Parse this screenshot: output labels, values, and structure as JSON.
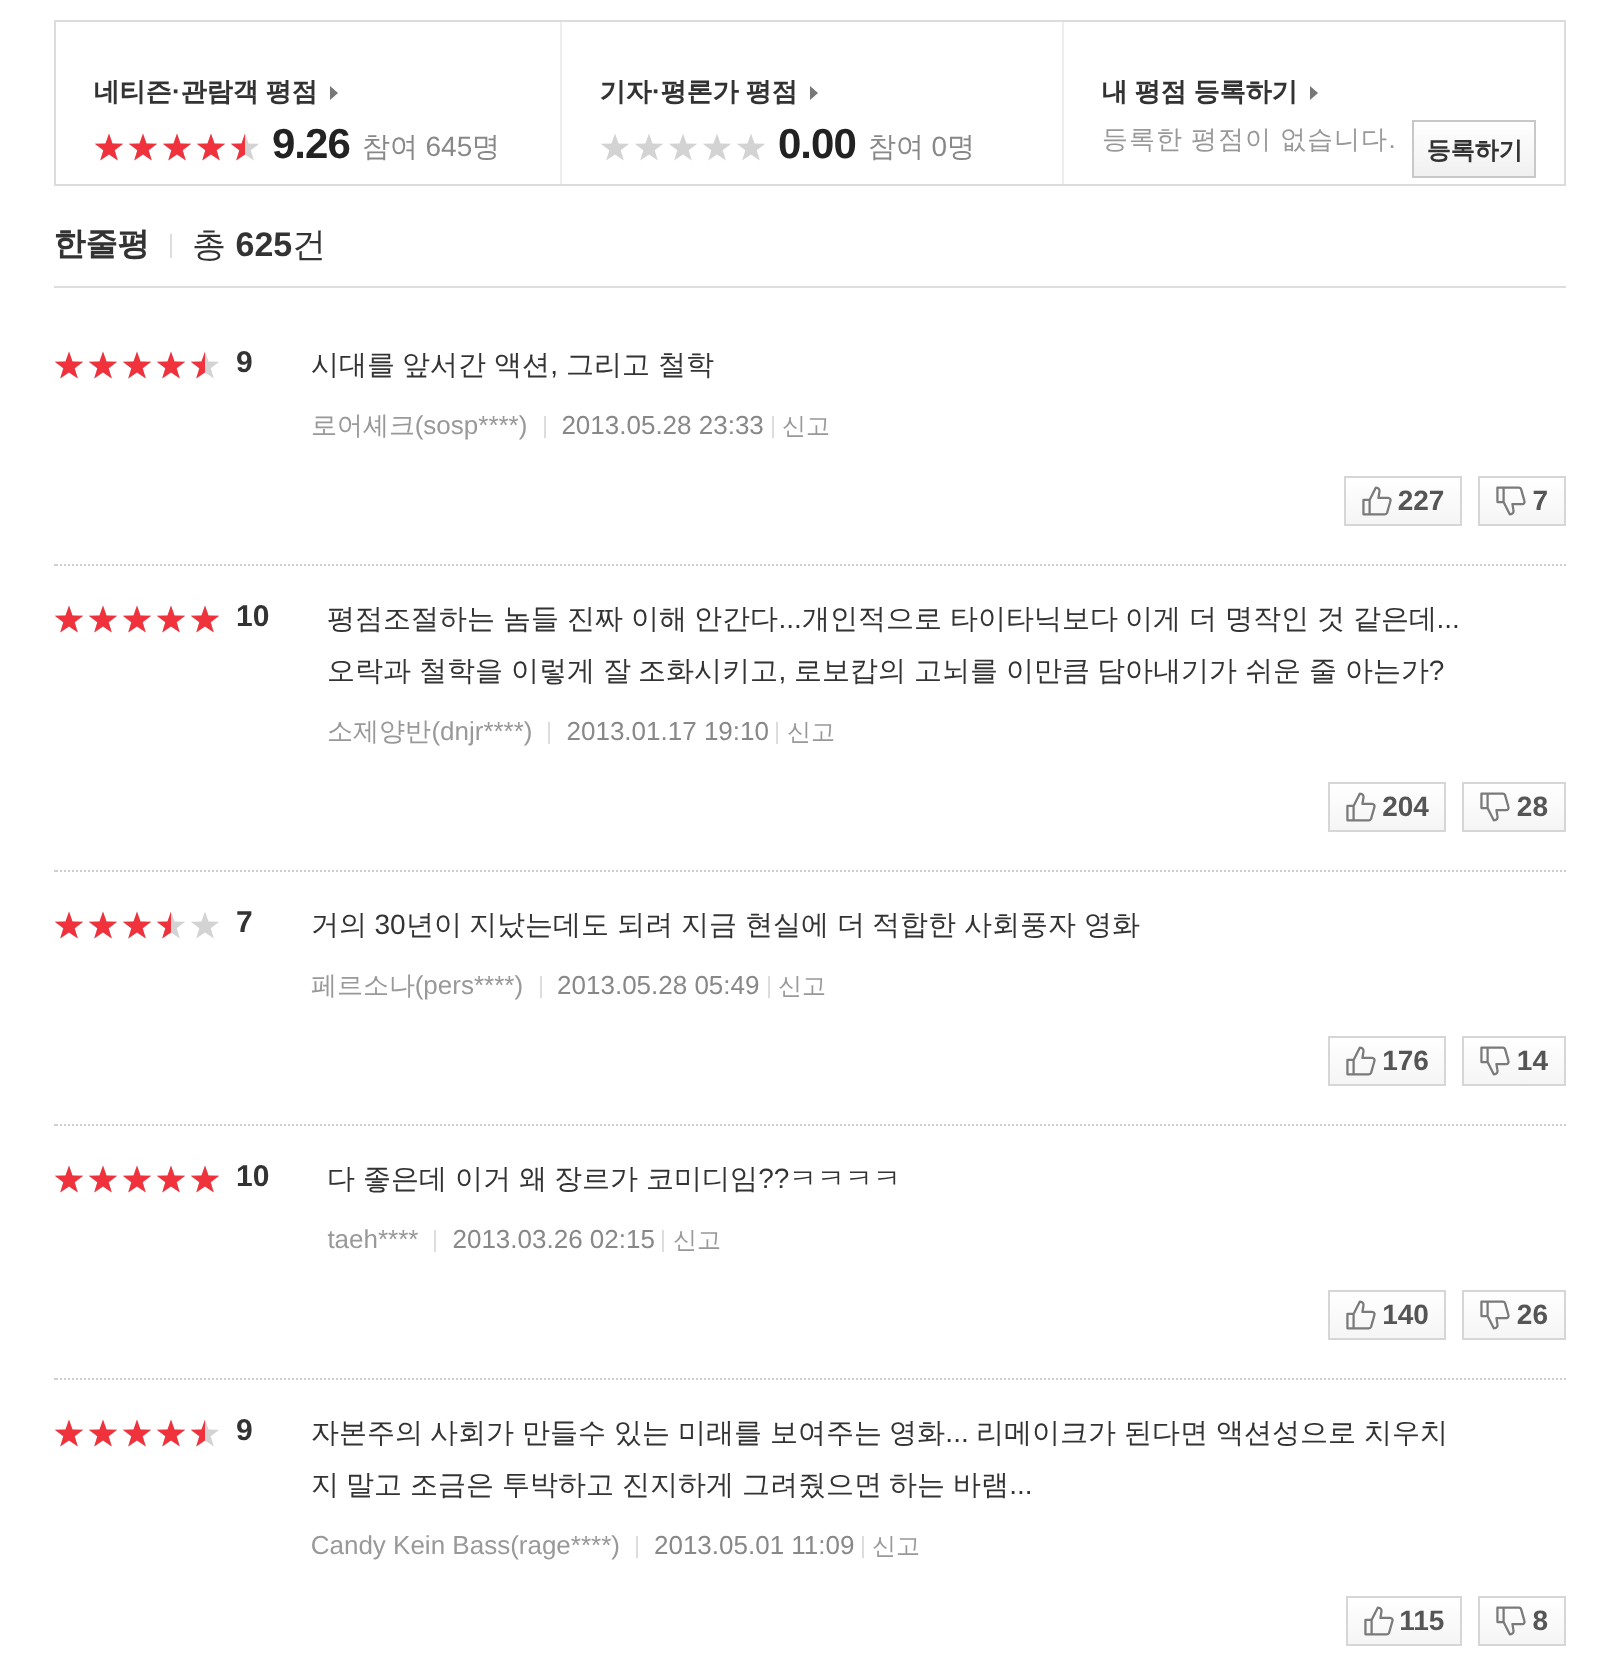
{
  "rating_summary": [
    {
      "kind": "score",
      "title": "네티즌·관람객 평점",
      "stars": 4.5,
      "score": "9.26",
      "participants": "참여 645명"
    },
    {
      "kind": "score",
      "title": "기자·평론가 평점",
      "stars": 0,
      "score": "0.00",
      "participants": "참여 0명"
    },
    {
      "kind": "register",
      "title": "내 평점 등록하기",
      "message": "등록한 평점이 없습니다.",
      "button": "등록하기"
    }
  ],
  "reviews_header": {
    "title": "한줄평",
    "total": "총 **625**건"
  },
  "reviews": [
    {
      "stars": 4.5,
      "score": "9",
      "lines": [
        "시대를 앞서간 액션, 그리고 철학"
      ],
      "author": "로어셰크(sosp****)",
      "date": "2013.05.28 23:33",
      "report": "신고",
      "likes": "227",
      "dislikes": "7"
    },
    {
      "stars": 5,
      "score": "10",
      "lines": [
        "평점조절하는 놈들 진짜 이해 안간다...개인적으로 타이타닉보다 이게 더 명작인 것 같은데...",
        "오락과 철학을 이렇게 잘 조화시키고, 로보캅의 고뇌를 이만큼 담아내기가 쉬운 줄 아는가?"
      ],
      "author": "소제양반(dnjr****)",
      "date": "2013.01.17 19:10",
      "report": "신고",
      "likes": "204",
      "dislikes": "28"
    },
    {
      "stars": 3.5,
      "score": "7",
      "lines": [
        "거의 30년이 지났는데도 되려 지금 현실에 더 적합한 사회풍자 영화"
      ],
      "author": "페르소나(pers****)",
      "date": "2013.05.28 05:49",
      "report": "신고",
      "likes": "176",
      "dislikes": "14"
    },
    {
      "stars": 5,
      "score": "10",
      "lines": [
        "다 좋은데 이거 왜 장르가 코미디임??ㅋㅋㅋㅋ"
      ],
      "author": "taeh****",
      "date": "2013.03.26 02:15",
      "report": "신고",
      "likes": "140",
      "dislikes": "26"
    },
    {
      "stars": 4.5,
      "score": "9",
      "lines": [
        "자본주의 사회가 만들수 있는 미래를 보여주는 영화... 리메이크가 된다면 액션성으로 치우치",
        "지 말고 조금은 투박하고 진지하게 그려줬으면 하는 바램..."
      ],
      "author": "Candy Kein Bass(rage****)",
      "date": "2013.05.01 11:09",
      "report": "신고",
      "likes": "115",
      "dislikes": "8"
    }
  ]
}
